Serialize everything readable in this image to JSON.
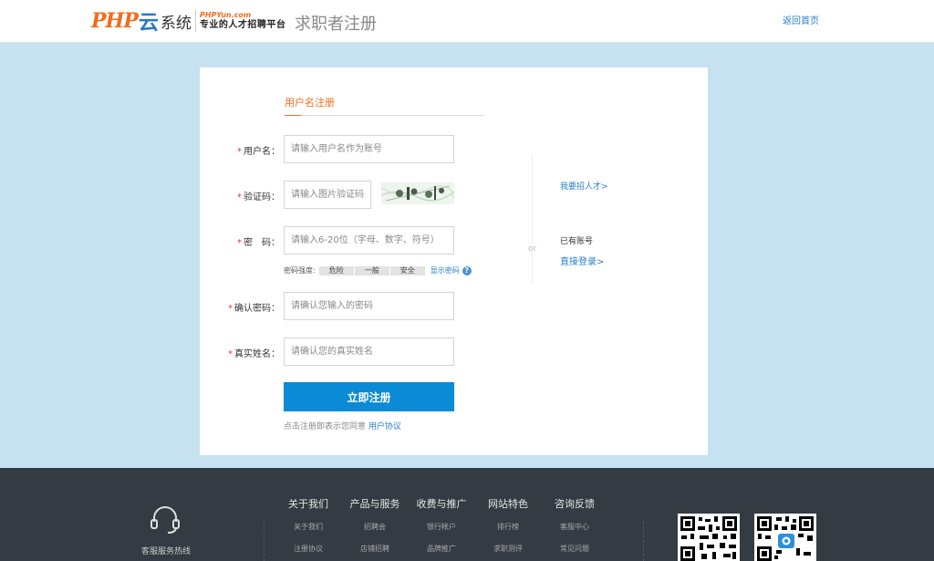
{
  "header": {
    "logo": {
      "php": "PHP",
      "yun": "云",
      "system": "系统",
      "site": "PHPYun.com",
      "slogan": "专业的人才招聘平台"
    },
    "title": "求职者注册",
    "back_home": "返回首页"
  },
  "form": {
    "tab": "用户名注册",
    "required_mark": "*",
    "fields": {
      "username": {
        "label": "用户名：",
        "placeholder": "请输入用户名作为账号"
      },
      "captcha": {
        "label": "验证码：",
        "placeholder": "请输入图片验证码"
      },
      "password": {
        "label": "密　码：",
        "placeholder": "请输入6-20位（字母、数字、符号）"
      },
      "confirm": {
        "label": "确认密码：",
        "placeholder": "请确认您输入的密码"
      },
      "realname": {
        "label": "真实姓名：",
        "placeholder": "请确认您的真实姓名"
      }
    },
    "strength": {
      "label": "密码强度:",
      "levels": [
        "危险",
        "一般",
        "安全"
      ],
      "show_password": "显示密码",
      "help_icon": "question-icon"
    },
    "submit": "立即注册",
    "agree_text": "点击注册即表示您同意",
    "agree_link": "用户协议"
  },
  "side": {
    "recruit_link": "我要招人才>",
    "or": "or",
    "have_account": "已有账号",
    "login_link": "直接登录>"
  },
  "footer": {
    "hotline_label": "客服服务热线",
    "hotline_icon": "headset-icon",
    "columns": [
      {
        "title": "关于我们",
        "items": [
          "关于我们",
          "注册协议"
        ]
      },
      {
        "title": "产品与服务",
        "items": [
          "招聘会",
          "店铺招聘"
        ]
      },
      {
        "title": "收费与推广",
        "items": [
          "银行帐户",
          "品牌推广"
        ]
      },
      {
        "title": "网站特色",
        "items": [
          "排行榜",
          "求职测评"
        ]
      },
      {
        "title": "咨询反馈",
        "items": [
          "客服中心",
          "常见问题"
        ]
      }
    ],
    "qr_codes": [
      "qr-code-icon",
      "qr-code-icon"
    ]
  },
  "colors": {
    "accent": "#f26c1a",
    "primary": "#0b8ad6",
    "link": "#2a7fc9",
    "background": "#c6e2f1",
    "footer": "#343b42"
  }
}
